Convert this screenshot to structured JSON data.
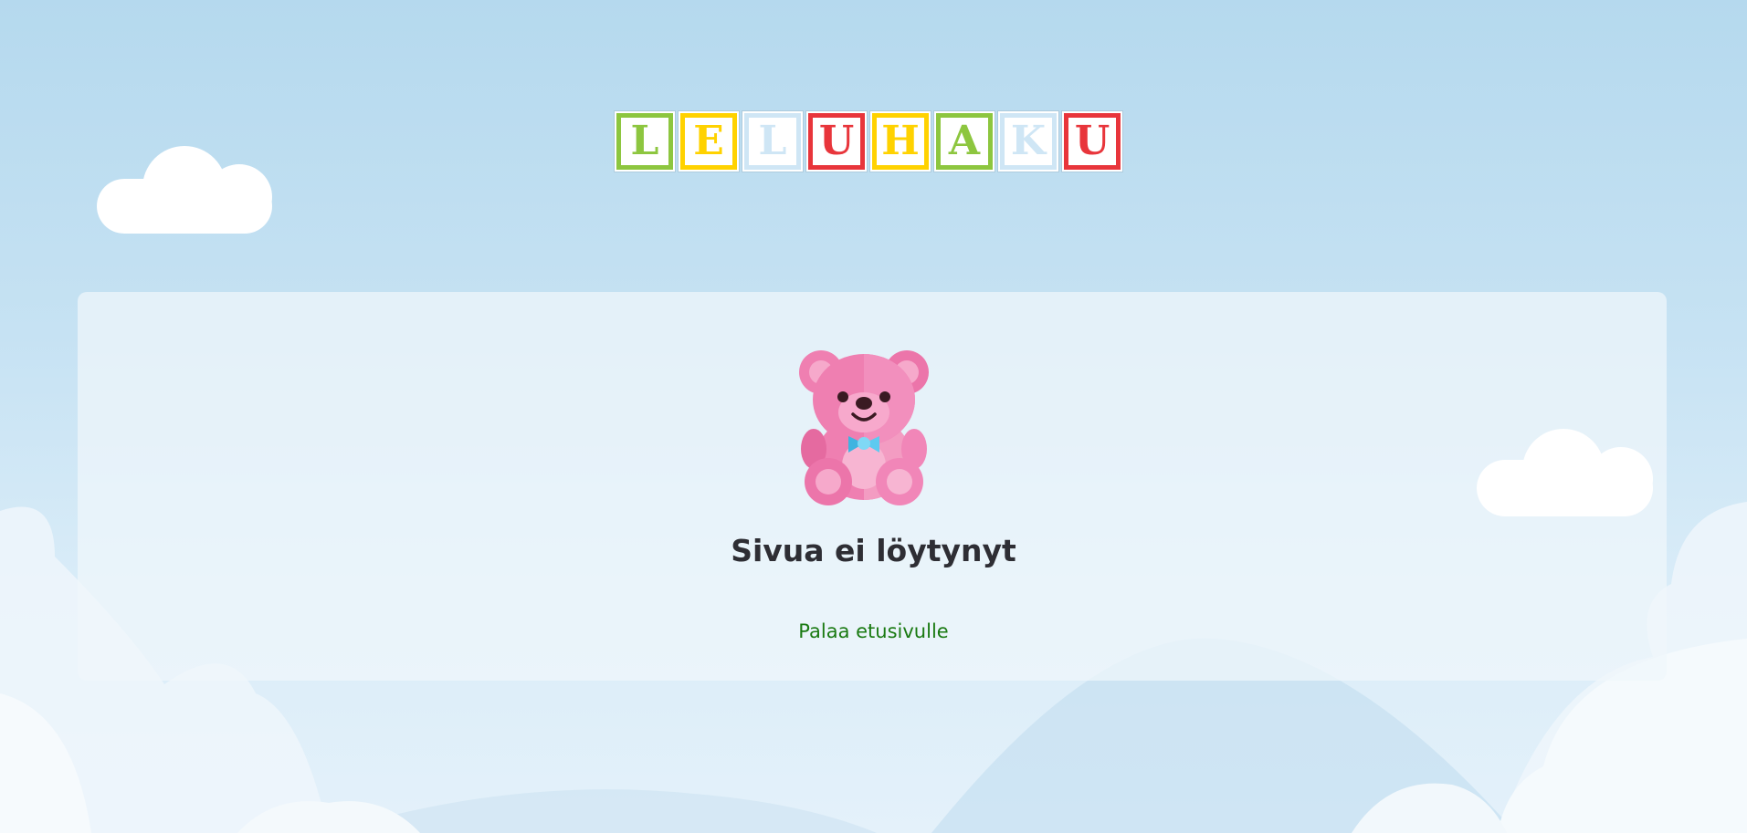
{
  "logo": {
    "letters": [
      {
        "char": "L",
        "bg": "#8dc63f",
        "fg": "#8dc63f"
      },
      {
        "char": "E",
        "bg": "#ffd200",
        "fg": "#ffd200"
      },
      {
        "char": "L",
        "bg": "#cfe6f5",
        "fg": "#cfe6f5"
      },
      {
        "char": "U",
        "bg": "#e8353b",
        "fg": "#e8353b"
      },
      {
        "char": "H",
        "bg": "#ffd200",
        "fg": "#ffd200"
      },
      {
        "char": "A",
        "bg": "#8dc63f",
        "fg": "#8dc63f"
      },
      {
        "char": "K",
        "bg": "#cfe6f5",
        "fg": "#cfe6f5"
      },
      {
        "char": "U",
        "bg": "#e8353b",
        "fg": "#e8353b"
      }
    ]
  },
  "main": {
    "icon": "teddy-bear-icon",
    "title": "Sivua ei löytynyt",
    "link_label": "Palaa etusivulle"
  },
  "colors": {
    "link": "#1a7a12",
    "title": "#2e2e34",
    "bear_pink": "#ef84b4",
    "bow": "#4fc3e8"
  }
}
